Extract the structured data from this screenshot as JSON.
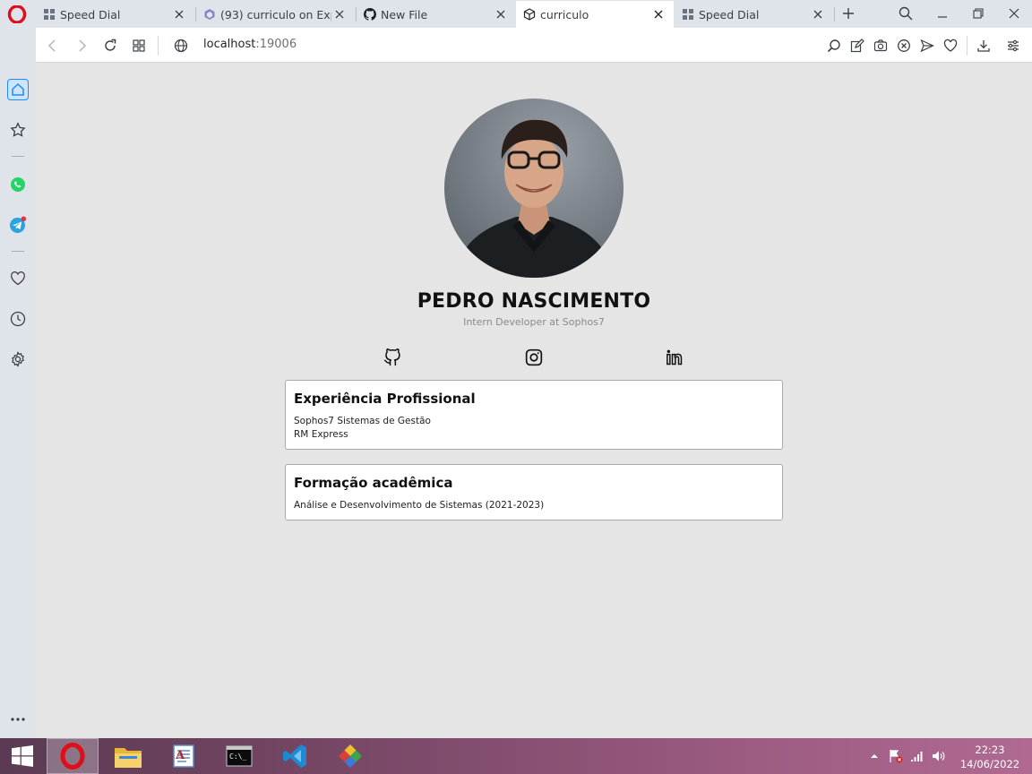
{
  "tabs": [
    {
      "label": "Speed Dial",
      "icon": "speed-dial-icon"
    },
    {
      "label": "(93) curriculo on Expo S",
      "icon": "expo-icon"
    },
    {
      "label": "New File",
      "icon": "github-icon"
    },
    {
      "label": "curriculo",
      "icon": "codesandbox-icon",
      "active": true
    },
    {
      "label": "Speed Dial",
      "icon": "speed-dial-icon"
    }
  ],
  "address": {
    "host": "localhost",
    "port": ":19006"
  },
  "profile": {
    "name": "PEDRO NASCIMENTO",
    "subtitle": "Intern Developer at Sophos7"
  },
  "social": [
    "github-icon",
    "instagram-icon",
    "linkedin-icon"
  ],
  "sections": {
    "experience": {
      "title": "Experiência Profissional",
      "items": [
        "Sophos7 Sistemas de Gestão",
        "RM Express"
      ]
    },
    "education": {
      "title": "Formação acadêmica",
      "items": [
        "Análise e Desenvolvimento de Sistemas (2021-2023)"
      ]
    }
  },
  "clock": {
    "time": "22:23",
    "date": "14/06/2022"
  },
  "colors": {
    "accent": "#1a8cff",
    "opera_red": "#e00d1b",
    "page_bg": "#e5e5e5"
  }
}
